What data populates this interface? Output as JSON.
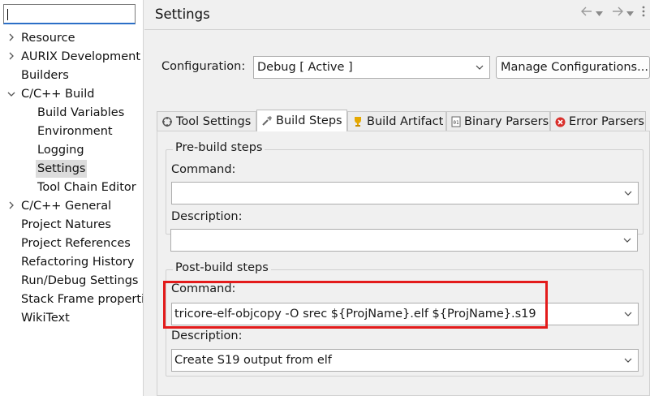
{
  "tree": {
    "filter_value": "",
    "items": [
      {
        "label": "Resource",
        "expandable": true,
        "expanded": false,
        "indent": 0
      },
      {
        "label": "AURIX Development Studio",
        "expandable": true,
        "expanded": false,
        "indent": 0
      },
      {
        "label": "Builders",
        "expandable": false,
        "indent": 0
      },
      {
        "label": "C/C++ Build",
        "expandable": true,
        "expanded": true,
        "indent": 0
      },
      {
        "label": "Build Variables",
        "expandable": false,
        "indent": 1
      },
      {
        "label": "Environment",
        "expandable": false,
        "indent": 1
      },
      {
        "label": "Logging",
        "expandable": false,
        "indent": 1
      },
      {
        "label": "Settings",
        "expandable": false,
        "indent": 1,
        "selected": true
      },
      {
        "label": "Tool Chain Editor",
        "expandable": false,
        "indent": 1
      },
      {
        "label": "C/C++ General",
        "expandable": true,
        "expanded": false,
        "indent": 0
      },
      {
        "label": "Project Natures",
        "expandable": false,
        "indent": 0
      },
      {
        "label": "Project References",
        "expandable": false,
        "indent": 0
      },
      {
        "label": "Refactoring History",
        "expandable": false,
        "indent": 0
      },
      {
        "label": "Run/Debug Settings",
        "expandable": false,
        "indent": 0
      },
      {
        "label": "Stack Frame properties",
        "expandable": false,
        "indent": 0
      },
      {
        "label": "WikiText",
        "expandable": false,
        "indent": 0
      }
    ]
  },
  "header": {
    "title": "Settings",
    "back_icon": "back-arrow-icon",
    "forward_icon": "forward-arrow-icon"
  },
  "configuration": {
    "label": "Configuration:",
    "value": "Debug  [ Active ]",
    "manage_button": "Manage Configurations..."
  },
  "tabs": [
    {
      "label": "Tool Settings",
      "icon": "tool-settings-icon",
      "active": false
    },
    {
      "label": "Build Steps",
      "icon": "build-steps-icon",
      "active": true
    },
    {
      "label": "Build Artifact",
      "icon": "trophy-icon",
      "active": false
    },
    {
      "label": "Binary Parsers",
      "icon": "binary-icon",
      "active": false
    },
    {
      "label": "Error Parsers",
      "icon": "error-icon",
      "active": false
    }
  ],
  "pre_build": {
    "title": "Pre-build steps",
    "command_label": "Command:",
    "command_value": "",
    "description_label": "Description:",
    "description_value": ""
  },
  "post_build": {
    "title": "Post-build steps",
    "command_label": "Command:",
    "command_value": "tricore-elf-objcopy -O srec ${ProjName}.elf  ${ProjName}.s19",
    "description_label": "Description:",
    "description_value": "Create S19 output from elf"
  },
  "colors": {
    "highlight_box": "#e31b1b",
    "selection": "#dcdcdc",
    "focus_underline": "#2b6fc7"
  }
}
